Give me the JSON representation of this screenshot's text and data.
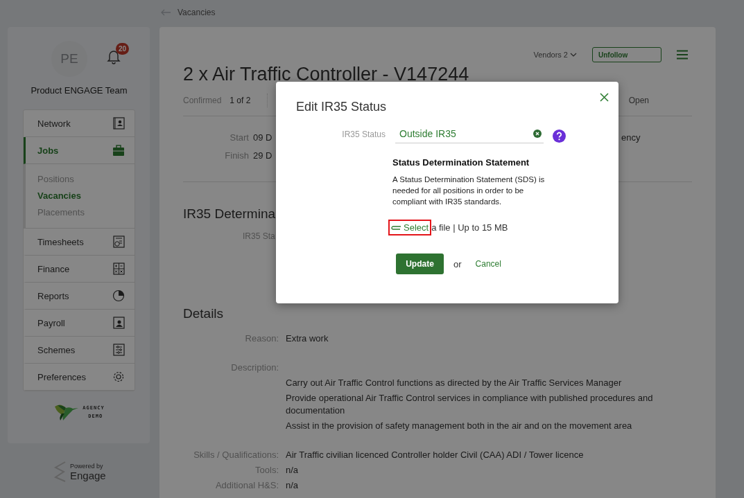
{
  "breadcrumb": {
    "label": "Vacancies"
  },
  "sidebar": {
    "avatar_initials": "PE",
    "notifications": "20",
    "team_name": "Product ENGAGE Team",
    "nav": [
      {
        "label": "Network",
        "selected": false
      },
      {
        "label": "Jobs",
        "selected": true,
        "children": [
          {
            "label": "Positions",
            "selected": false
          },
          {
            "label": "Vacancies",
            "selected": true
          },
          {
            "label": "Placements",
            "selected": false
          }
        ]
      },
      {
        "label": "Timesheets",
        "selected": false
      },
      {
        "label": "Finance",
        "selected": false
      },
      {
        "label": "Reports",
        "selected": false
      },
      {
        "label": "Payroll",
        "selected": false
      },
      {
        "label": "Schemes",
        "selected": false
      },
      {
        "label": "Preferences",
        "selected": false
      }
    ],
    "logo": {
      "line1": "AGENCY",
      "line2": "DEMO"
    },
    "powered_by": {
      "caption": "Powered by",
      "brand": "Engage"
    }
  },
  "page": {
    "vendors": "Vendors 2",
    "follow_button": "Unfollow",
    "title": "2 x Air Traffic Controller - V147244",
    "summary": {
      "label": "Confirmed",
      "value": "1 of 2"
    },
    "status_fragment": "Open",
    "dates": [
      {
        "label": "Start",
        "value": "09 D"
      },
      {
        "label": "Finish",
        "value": "29 D"
      }
    ],
    "dates_fragment": "ency",
    "ir35_heading": "IR35 Determina",
    "ir35_label": "IR35 Sta",
    "details_heading": "Details",
    "details": [
      {
        "kind": "inline",
        "label": "Reason:",
        "lines": [
          "Extra work"
        ]
      },
      {
        "kind": "below",
        "label": "Description:",
        "lines": [
          "Carry out Air Traffic Control functions as directed by the Air Traffic Services Manager",
          "Provide operational Air Traffic Control services in compliance with published procedures and documentation",
          "Assist in the provision of safety management both in the air and on the movement area"
        ]
      },
      {
        "kind": "inline",
        "label": "Skills / Qualifications:",
        "lines": [
          "Air Traffic civilian licenced Controller holder Civil (CAA) ADI / Tower licence"
        ]
      },
      {
        "kind": "inline",
        "label": "Tools:",
        "lines": [
          "n/a"
        ]
      },
      {
        "kind": "inline",
        "label": "Additional H&S:",
        "lines": [
          "n/a"
        ]
      }
    ]
  },
  "modal": {
    "title": "Edit IR35 Status",
    "field": {
      "label": "IR35 Status",
      "value": "Outside IR35"
    },
    "sds": {
      "heading": "Status Determination Statement",
      "text": "A Status Determination Statement (SDS) is needed for all positions in order to be compliant with IR35 standards."
    },
    "upload": {
      "link": "Select",
      "text": "a file | Up to 15 MB",
      "highlighted": true
    },
    "primary_button": "Update",
    "separator": "or",
    "cancel_link": "Cancel"
  }
}
